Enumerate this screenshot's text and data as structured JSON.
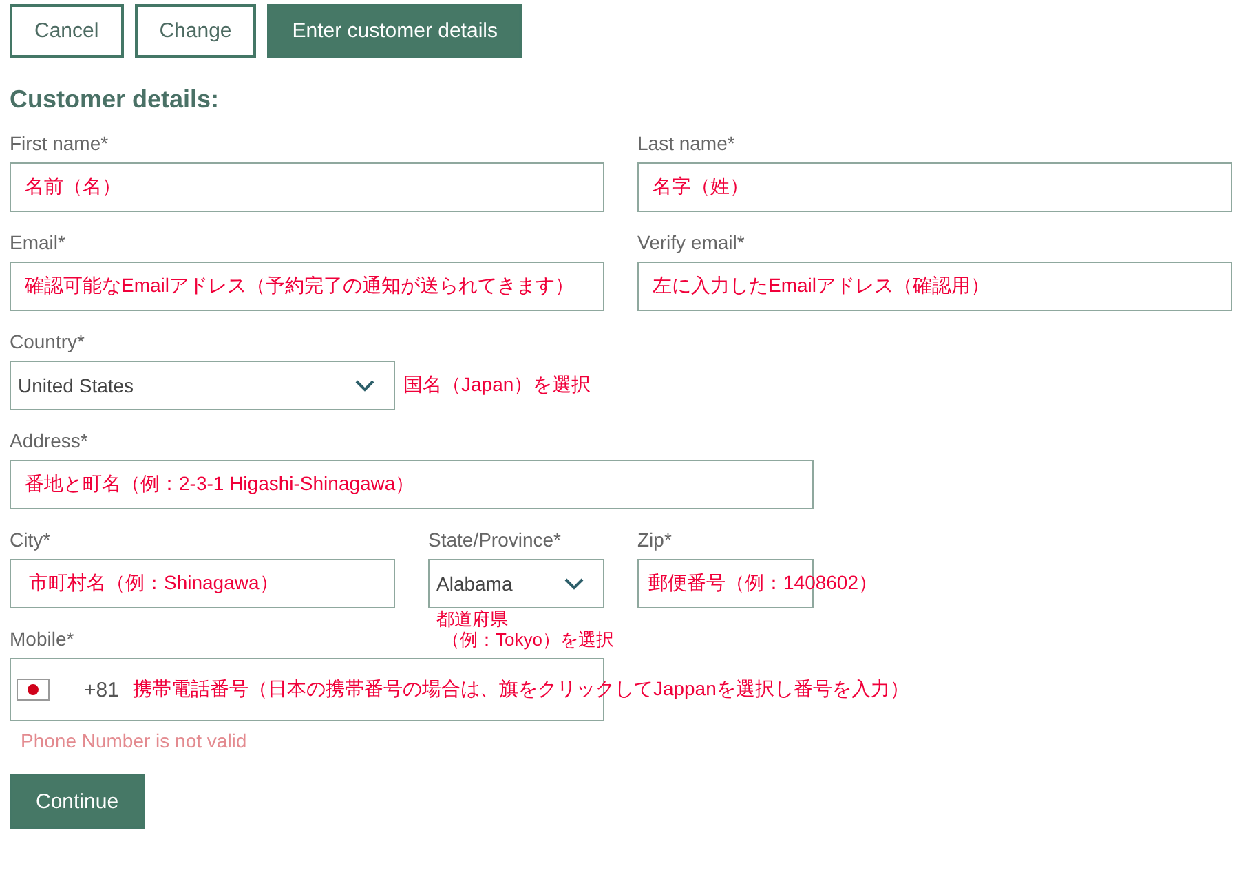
{
  "buttons": [
    {
      "label": "Cancel",
      "kind": "outline"
    },
    {
      "label": "Change",
      "kind": "outline"
    },
    {
      "label": "Enter customer details",
      "kind": "filled"
    }
  ],
  "heading": "Customer details:",
  "first_name": {
    "label": "First name*",
    "value": "名前（名）"
  },
  "last_name": {
    "label": "Last name*",
    "value": "名字（姓）"
  },
  "email": {
    "label": "Email*",
    "value": "確認可能なEmailアドレス（予約完了の通知が送られてきます）"
  },
  "verify_email": {
    "label": "Verify email*",
    "value": "左に入力したEmailアドレス（確認用）"
  },
  "country": {
    "label": "Country*",
    "value": "United States",
    "note": "国名（Japan）を選択"
  },
  "address": {
    "label": "Address*",
    "value": "番地と町名（例：2-3-1 Higashi-Shinagawa）"
  },
  "city": {
    "label": "City*",
    "value": "市町村名（例：Shinagawa）"
  },
  "state": {
    "label": "State/Province*",
    "value": "Alabama",
    "note_lines": [
      "都道府県",
      "（例：Tokyo）を選択"
    ]
  },
  "zip": {
    "label": "Zip*",
    "value": "郵便番号（例：1408602）"
  },
  "mobile": {
    "label": "Mobile*",
    "dial_code": "+81",
    "value": "携帯電話番号（日本の携帯番号の場合は、旗をクリックしてJappanを選択し番号を入力）",
    "error": "Phone Number is not valid"
  },
  "continue_button": "Continue"
}
